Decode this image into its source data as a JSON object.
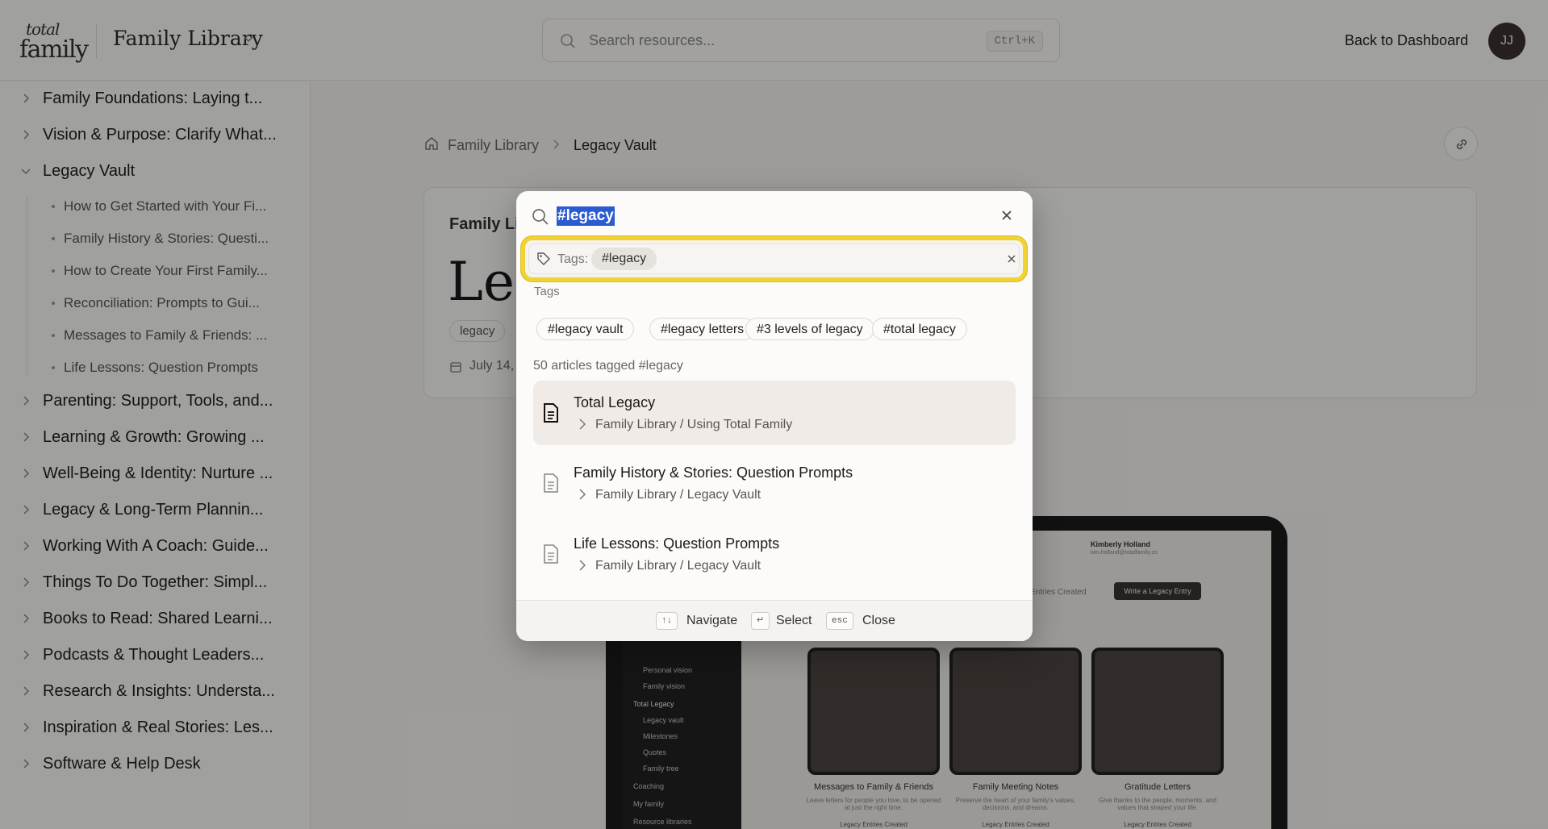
{
  "header": {
    "logo_top": "total",
    "logo_bottom": "family",
    "library_title": "Family Library",
    "search_placeholder": "Search resources...",
    "search_shortcut": "Ctrl+K",
    "back_link": "Back to Dashboard",
    "avatar_initials": "JJ"
  },
  "sidebar": {
    "items": [
      {
        "label": "Family Foundations: Laying t..."
      },
      {
        "label": "Vision & Purpose: Clarify What..."
      },
      {
        "label": "Legacy Vault"
      },
      {
        "label": "Parenting: Support, Tools, and..."
      },
      {
        "label": "Learning & Growth: Growing ..."
      },
      {
        "label": "Well-Being & Identity: Nurture ..."
      },
      {
        "label": "Legacy & Long-Term Plannin..."
      },
      {
        "label": "Working With A Coach: Guide..."
      },
      {
        "label": "Things To Do Together: Simpl..."
      },
      {
        "label": "Books to Read: Shared Learni..."
      },
      {
        "label": "Podcasts & Thought Leaders..."
      },
      {
        "label": "Research & Insights: Understa..."
      },
      {
        "label": "Inspiration & Real Stories: Les..."
      },
      {
        "label": "Software & Help Desk"
      }
    ],
    "subitems": [
      {
        "label": "How to Get Started with Your Fi..."
      },
      {
        "label": "Family History & Stories: Questi..."
      },
      {
        "label": "How to Create Your First Family..."
      },
      {
        "label": "Reconciliation: Prompts to Gui..."
      },
      {
        "label": "Messages to Family & Friends: ..."
      },
      {
        "label": "Life Lessons: Question Prompts"
      }
    ]
  },
  "main": {
    "breadcrumb": [
      "Family Library",
      "Legacy Vault"
    ],
    "eyebrow": "Family Li",
    "title": "Leg",
    "tag": "legacy",
    "date": "July 14, 2"
  },
  "mockup": {
    "sidebar_rows": [
      "Personal vision",
      "Family vision",
      "Total Legacy",
      "Legacy vault",
      "Milestones",
      "Quotes",
      "Family tree",
      "Coaching",
      "My family",
      "Resource libraries"
    ],
    "user_name": "Kimberly Holland",
    "user_email": "kim.holland@totalfamily.co",
    "entries_created": "Legacy Entries Created",
    "write_button": "Write a Legacy Entry",
    "tiles": [
      {
        "label": "Messages to Family & Friends",
        "desc": "Leave letters for people you love, to be opened at just the right time.",
        "foot": "Legacy Entries Created"
      },
      {
        "label": "Family Meeting Notes",
        "desc": "Preserve the heart of your family's values, decisions, and dreams.",
        "foot": "Legacy Entries Created"
      },
      {
        "label": "Gratitude Letters",
        "desc": "Give thanks to the people, moments, and values that shaped your life.",
        "foot": "Legacy Entries Created"
      }
    ]
  },
  "modal": {
    "query": "#legacy",
    "tag_filter_label": "Tags:",
    "tag_filter_value": "#legacy",
    "tags_heading": "Tags",
    "suggested_tags": [
      "#legacy vault",
      "#legacy letters",
      "#3 levels of legacy",
      "#total legacy"
    ],
    "count_text": "50 articles tagged #legacy",
    "results": [
      {
        "title": "Total Legacy",
        "path": "Family Library / Using Total Family"
      },
      {
        "title": "Family History & Stories: Question Prompts",
        "path": "Family Library / Legacy Vault"
      },
      {
        "title": "Life Lessons: Question Prompts",
        "path": "Family Library / Legacy Vault"
      }
    ],
    "footer": {
      "navigate_key": "↑↓",
      "navigate_label": "Navigate",
      "select_key": "↵",
      "select_label": "Select",
      "close_key": "esc",
      "close_label": "Close"
    }
  }
}
